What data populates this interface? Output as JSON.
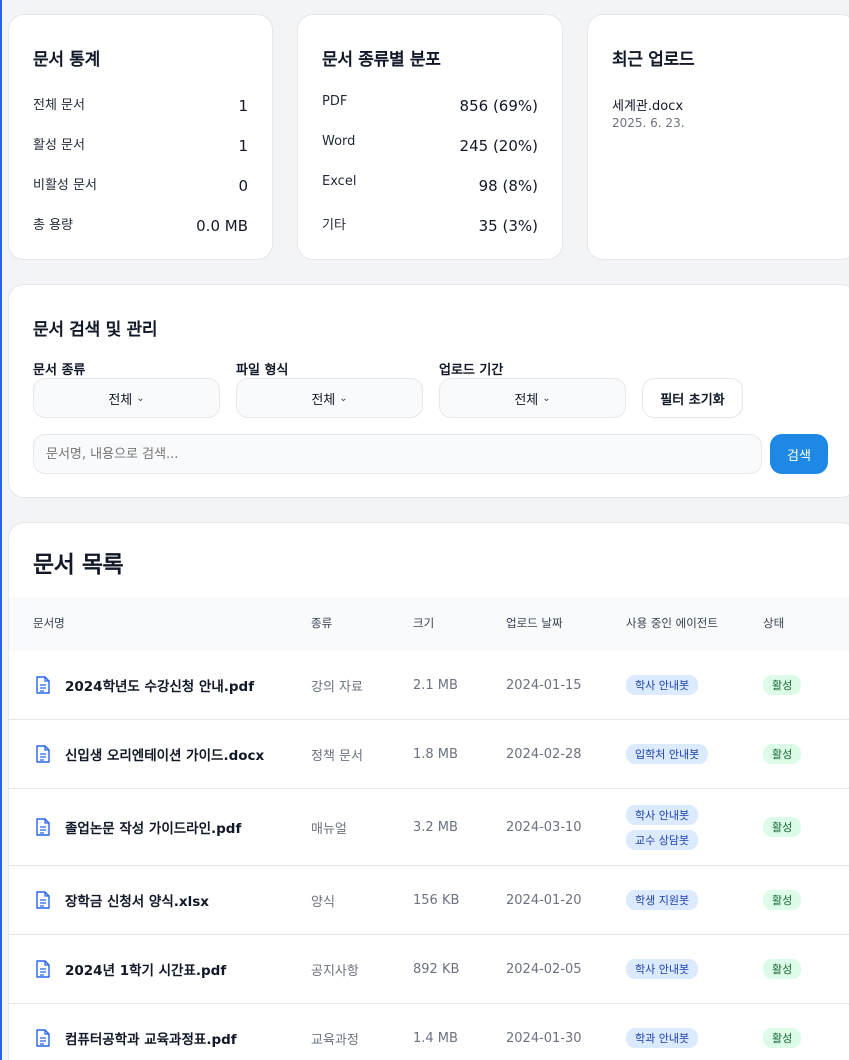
{
  "stats": {
    "title": "문서 통계",
    "rows": [
      {
        "label": "전체 문서",
        "value": "1"
      },
      {
        "label": "활성 문서",
        "value": "1"
      },
      {
        "label": "비활성 문서",
        "value": "0"
      },
      {
        "label": "총 용량",
        "value": "0.0 MB"
      }
    ]
  },
  "distribution": {
    "title": "문서 종류별 분포",
    "rows": [
      {
        "label": "PDF",
        "value": "856 (69%)"
      },
      {
        "label": "Word",
        "value": "245 (20%)"
      },
      {
        "label": "Excel",
        "value": "98 (8%)"
      },
      {
        "label": "기타",
        "value": "35 (3%)"
      }
    ]
  },
  "recent": {
    "title": "최근 업로드",
    "file_name": "세계관.docx",
    "date": "2025. 6. 23."
  },
  "search": {
    "title": "문서 검색 및 관리",
    "filters": [
      {
        "label": "문서 종류",
        "value": "전체"
      },
      {
        "label": "파일 형식",
        "value": "전체"
      },
      {
        "label": "업로드 기간",
        "value": "전체"
      }
    ],
    "reset_label": "필터 초기화",
    "placeholder": "문서명, 내용으로 검색...",
    "search_button": "검색"
  },
  "list": {
    "title": "문서 목록",
    "columns": [
      "문서명",
      "종류",
      "크기",
      "업로드 날짜",
      "사용 중인 에이전트",
      "상태"
    ],
    "rows": [
      {
        "name": "2024학년도 수강신청 안내.pdf",
        "type": "강의 자료",
        "size": "2.1 MB",
        "date": "2024-01-15",
        "agents": [
          "학사 안내봇"
        ],
        "status": "활성"
      },
      {
        "name": "신입생 오리엔테이션 가이드.docx",
        "type": "정책 문서",
        "size": "1.8 MB",
        "date": "2024-02-28",
        "agents": [
          "입학처 안내봇"
        ],
        "status": "활성"
      },
      {
        "name": "졸업논문 작성 가이드라인.pdf",
        "type": "매뉴얼",
        "size": "3.2 MB",
        "date": "2024-03-10",
        "agents": [
          "학사 안내봇",
          "교수 상담봇"
        ],
        "status": "활성"
      },
      {
        "name": "장학금 신청서 양식.xlsx",
        "type": "양식",
        "size": "156 KB",
        "date": "2024-01-20",
        "agents": [
          "학생 지원봇"
        ],
        "status": "활성"
      },
      {
        "name": "2024년 1학기 시간표.pdf",
        "type": "공지사항",
        "size": "892 KB",
        "date": "2024-02-05",
        "agents": [
          "학사 안내봇"
        ],
        "status": "활성"
      },
      {
        "name": "컴퓨터공학과 교육과정표.pdf",
        "type": "교육과정",
        "size": "1.4 MB",
        "date": "2024-01-30",
        "agents": [
          "학과 안내봇"
        ],
        "status": "활성"
      }
    ]
  },
  "colors": {
    "accent": "#1e88e5",
    "agent_badge": "#dbeafe",
    "status_badge": "#dcfce7"
  }
}
